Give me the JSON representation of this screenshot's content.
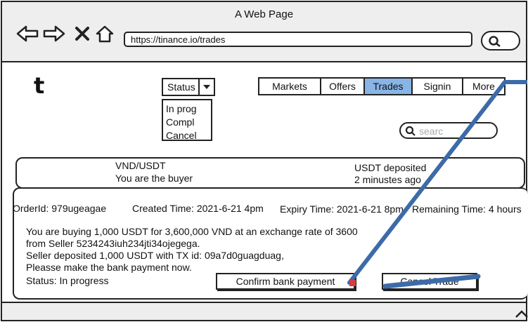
{
  "window": {
    "title": "A Web Page"
  },
  "browser": {
    "url": "https://tinance.io/trades",
    "back_icon": "left-arrow-icon",
    "forward_icon": "right-arrow-icon",
    "close_icon": "x-icon",
    "home_icon": "home-icon",
    "search_icon": "search-icon"
  },
  "logo": "t",
  "status_filter": {
    "label": "Status",
    "options": [
      "In prog",
      "Compl",
      "Cancel"
    ]
  },
  "nav": {
    "tabs": [
      {
        "label": "Markets",
        "active": false
      },
      {
        "label": "Offers",
        "active": false
      },
      {
        "label": "Trades",
        "active": true
      },
      {
        "label": "Signin",
        "active": false
      },
      {
        "label": "More",
        "active": false
      }
    ]
  },
  "search": {
    "placeholder": "searc"
  },
  "trade_card": {
    "pair": "VND/USDT",
    "role": "You are the buyer",
    "status": "USDT deposited",
    "time_ago": "2 minustes ago"
  },
  "order": {
    "id": "OrderId: 979ugeagae",
    "created": "Created Time: 2021-6-21 4pm",
    "expiry": "Expiry Time: 2021-6-21 8pm",
    "remaining": "Remaining Time: 4 hours",
    "lines": [
      "You are buying 1,000 USDT for 3,600,000 VND at an exchange rate of 3600",
      "from Seller 5234243iuh234jti34ojegega.",
      "Seller deposited 1,000 USDT with TX id: 09a7d0guagduag,",
      "Pleasse make the bank payment now."
    ],
    "status": "Status: In progress"
  },
  "actions": {
    "confirm_label": "Confirm bank payment",
    "cancel_label": "Cancel Trade"
  },
  "colors": {
    "active_tab": "#88b4e6",
    "annotation_line": "#3d6aa8",
    "chrome_bg": "#eeeeee"
  }
}
